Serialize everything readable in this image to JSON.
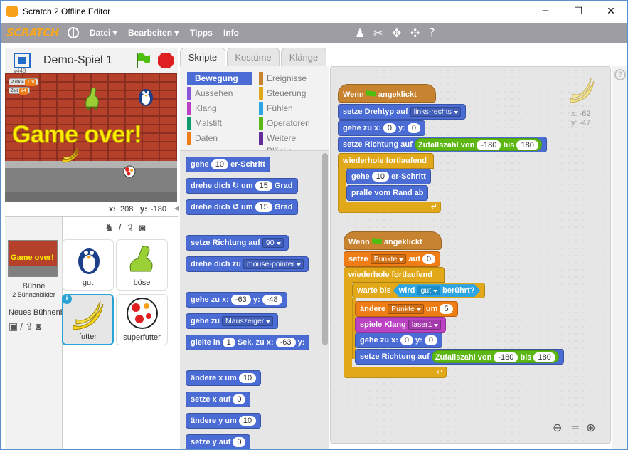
{
  "window": {
    "title": "Scratch 2 Offline Editor",
    "min": "─",
    "max": "☐",
    "close": "✕"
  },
  "menu": {
    "logo": "SCRATCH",
    "file": "Datei ▾",
    "edit": "Bearbeiten ▾",
    "tips": "Tipps",
    "info": "Info"
  },
  "stage": {
    "name": "Demo-Spiel 1",
    "version": "v448",
    "game_over": "Game over!",
    "mon_points_label": "Punkte",
    "mon_points_value": "170",
    "mon_time_label": "Zeit",
    "mon_time_value": "24",
    "coord_x_label": "x:",
    "coord_x": "208",
    "coord_y_label": "y:",
    "coord_y": "-180"
  },
  "sprites": {
    "stage_label": "Bühne",
    "stage_sub": "2 Bühnenbilder",
    "stage_thumb_text": "Game over!",
    "new_bg": "Neues Bühnenbild",
    "items": [
      {
        "label": "gut"
      },
      {
        "label": "böse"
      },
      {
        "label": "futter"
      },
      {
        "label": "superfutter"
      }
    ]
  },
  "tabs": [
    "Skripte",
    "Kostüme",
    "Klänge"
  ],
  "categories": [
    {
      "label": "Bewegung",
      "color": "#4a6cd4"
    },
    {
      "label": "Ereignisse",
      "color": "#c88330"
    },
    {
      "label": "Aussehen",
      "color": "#8a55d7"
    },
    {
      "label": "Steuerung",
      "color": "#e1a91a"
    },
    {
      "label": "Klang",
      "color": "#bb42c3"
    },
    {
      "label": "Fühlen",
      "color": "#2ca5e2"
    },
    {
      "label": "Malstift",
      "color": "#0e9a6c"
    },
    {
      "label": "Operatoren",
      "color": "#5cb712"
    },
    {
      "label": "Daten",
      "color": "#ee7d16"
    },
    {
      "label": "Weitere Blöcke",
      "color": "#632d99"
    }
  ],
  "palette": {
    "move": [
      "gehe",
      "10",
      "er-Schritt"
    ],
    "turn_r": [
      "drehe dich",
      "um",
      "15",
      "Grad"
    ],
    "turn_l": [
      "drehe dich",
      "um",
      "15",
      "Grad"
    ],
    "point_dir": [
      "setze Richtung auf",
      "90"
    ],
    "point_to": [
      "drehe dich zu",
      "mouse-pointer"
    ],
    "goto_xy": [
      "gehe zu x:",
      "-63",
      "y:",
      "-48"
    ],
    "goto": [
      "gehe zu",
      "Mauszeiger"
    ],
    "glide": [
      "gleite in",
      "1",
      "Sek. zu x:",
      "-63",
      "y:"
    ],
    "change_x": [
      "ändere x um",
      "10"
    ],
    "set_x": [
      "setze x auf",
      "0"
    ],
    "change_y": [
      "ändere y um",
      "10"
    ],
    "set_y": [
      "setze y auf",
      "0"
    ]
  },
  "script1": {
    "hat": [
      "Wenn",
      "angeklickt"
    ],
    "rot": [
      "setze Drehtyp auf",
      "links-rechts"
    ],
    "goto": [
      "gehe zu x:",
      "0",
      "y:",
      "0"
    ],
    "dir": [
      "setze Richtung auf",
      "Zufallszahl von",
      "-180",
      "bis",
      "180"
    ],
    "forever": "wiederhole fortlaufend",
    "move": [
      "gehe",
      "10",
      "er-Schritt"
    ],
    "bounce": "pralle vom Rand ab"
  },
  "script2": {
    "hat": [
      "Wenn",
      "angeklickt"
    ],
    "setvar": [
      "setze",
      "Punkte",
      "auf",
      "0"
    ],
    "forever": "wiederhole fortlaufend",
    "wait": [
      "warte bis",
      "wird",
      "gut",
      "berührt?"
    ],
    "change": [
      "ändere",
      "Punkte",
      "um",
      "5"
    ],
    "sound": [
      "spiele Klang",
      "laser1"
    ],
    "goto": [
      "gehe zu x:",
      "0",
      "y:",
      "0"
    ],
    "dir": [
      "setze Richtung auf",
      "Zufallszahl von",
      "-180",
      "bis",
      "180"
    ]
  },
  "sprite_info": {
    "x_label": "x:",
    "x": "-62",
    "y_label": "y:",
    "y": "-47"
  },
  "colors": {
    "motion": "#4a6cd4",
    "events": "#c88330",
    "control": "#e1a91a",
    "operators": "#5cb712",
    "data": "#ee7d16",
    "sound": "#bb42c3",
    "sensing": "#2ca5e2"
  }
}
